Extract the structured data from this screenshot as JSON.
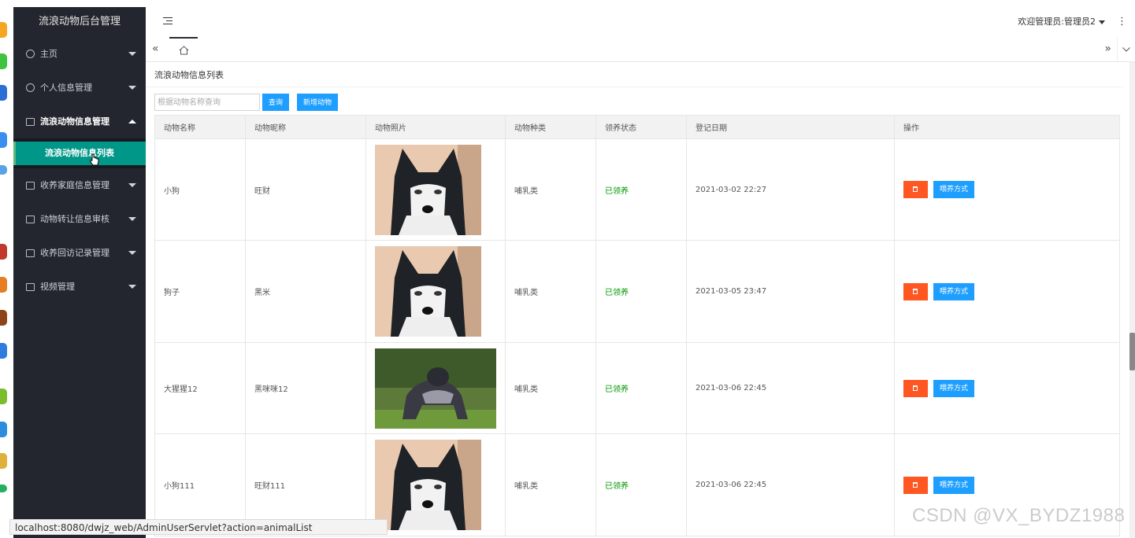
{
  "app": {
    "title": "流浪动物后台管理"
  },
  "sidebar": {
    "items": [
      {
        "label": "主页",
        "icon": "dashboard-icon"
      },
      {
        "label": "个人信息管理",
        "icon": "user-icon"
      },
      {
        "label": "流浪动物信息管理",
        "icon": "list-icon",
        "open": true,
        "sub": [
          {
            "label": "流浪动物信息列表",
            "active": true
          }
        ]
      },
      {
        "label": "收养家庭信息管理",
        "icon": "list-icon"
      },
      {
        "label": "动物转让信息审核",
        "icon": "list-icon"
      },
      {
        "label": "收养回访记录管理",
        "icon": "list-icon"
      },
      {
        "label": "视频管理",
        "icon": "list-icon"
      }
    ]
  },
  "header": {
    "user_label": "欢迎管理员:管理员2",
    "more": "⋮"
  },
  "tabs": {
    "left_arrow": "«",
    "right_arrow": "»"
  },
  "page": {
    "breadcrumb": "流浪动物信息列表",
    "search_placeholder": "根据动物名称查询",
    "query_label": "查询",
    "add_label": "新增动物"
  },
  "table": {
    "headers": [
      "动物名称",
      "动物昵称",
      "动物照片",
      "动物种类",
      "领养状态",
      "登记日期",
      "操作"
    ],
    "rows": [
      {
        "name": "小狗",
        "nickname": "旺财",
        "photo": "husky",
        "kind": "哺乳类",
        "status": "已领养",
        "date": "2021-03-02 22:27"
      },
      {
        "name": "狗子",
        "nickname": "黑米",
        "photo": "husky",
        "kind": "哺乳类",
        "status": "已领养",
        "date": "2021-03-05 23:47"
      },
      {
        "name": "大猩猩12",
        "nickname": "黑咪咪12",
        "photo": "gorilla",
        "kind": "哺乳类",
        "status": "已领养",
        "date": "2021-03-06 22:45"
      },
      {
        "name": "小狗111",
        "nickname": "旺财111",
        "photo": "husky",
        "kind": "哺乳类",
        "status": "已领养",
        "date": "2021-03-06 22:45"
      }
    ],
    "feed_label": "喂养方式"
  },
  "statusbar": {
    "url": "localhost:8080/dwjz_web/AdminUserServlet?action=animalList"
  },
  "watermark": "CSDN @VX_BYDZ1988",
  "colors": {
    "sidebar_bg": "#23262e",
    "active_green": "#009688",
    "primary_blue": "#1e9fff",
    "danger_orange": "#ff5722",
    "status_green": "#009600"
  }
}
